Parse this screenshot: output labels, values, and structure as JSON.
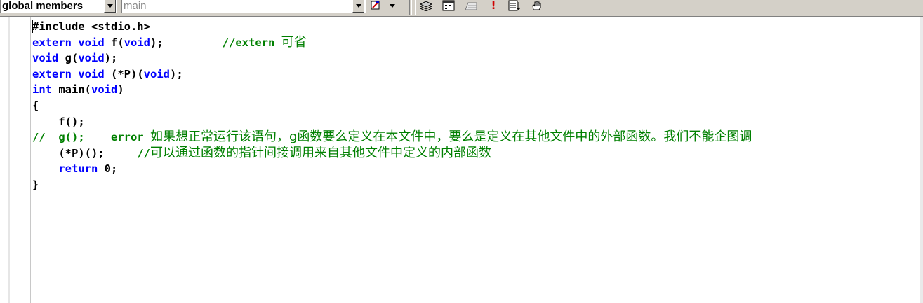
{
  "toolbar": {
    "scope_value": "global members",
    "function_value": "main",
    "icons": [
      "wizard-action-icon",
      "dropdown-arrow-icon",
      "books-icon",
      "calendar-icon",
      "ruler-icon",
      "exclamation-icon",
      "list-icon",
      "hand-icon"
    ]
  },
  "code": {
    "l1_text": "#include <stdio.h>",
    "l2_kw": "extern void",
    "l2_rest": " f(",
    "l2_kw2": "void",
    "l2_end": ");",
    "l2_comment": "//extern ",
    "l2_comment_cjk": "可省",
    "l3_kw": "void",
    "l3_rest": " g(",
    "l3_kw2": "void",
    "l3_end": ");",
    "l4_kw": "extern void",
    "l4_rest": " (*P)(",
    "l4_kw2": "void",
    "l4_end": ");",
    "l5_kw": "int",
    "l5_rest": " main(",
    "l5_kw2": "void",
    "l5_end": ")",
    "l6_text": "{",
    "l7_text": "    f();",
    "l8_comment_a": "//  g();    error ",
    "l8_comment_cjk": "如果想正常运行该语句，g函数要么定义在本文件中，要么是定义在其他文件中的外部函数。我们不能企图调",
    "l9_text": "    (*P)();     ",
    "l9_comment": "//",
    "l9_comment_cjk": "可以通过函数的指针间接调用来自其他文件中定义的内部函数",
    "l10_indent": "    ",
    "l10_kw": "return",
    "l10_rest": " 0;",
    "l11_text": "}"
  }
}
